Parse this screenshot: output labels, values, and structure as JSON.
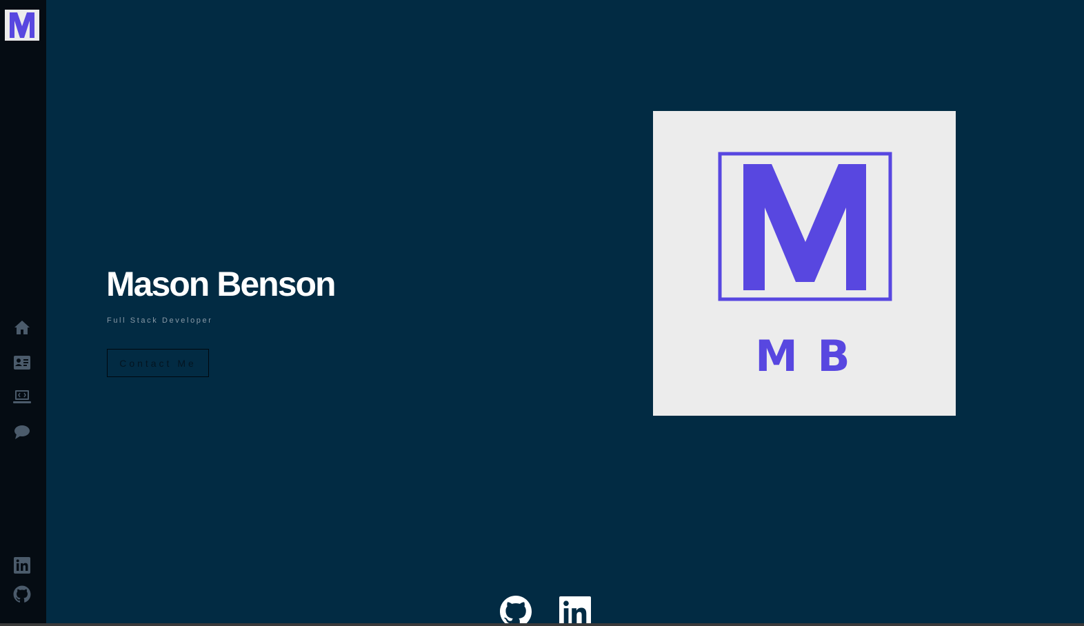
{
  "sidebar": {
    "logo_letter": "M",
    "nav": [
      {
        "name": "home",
        "icon": "home-icon"
      },
      {
        "name": "about",
        "icon": "contact-card-icon"
      },
      {
        "name": "projects",
        "icon": "laptop-code-icon"
      },
      {
        "name": "contact",
        "icon": "chat-bubble-icon"
      }
    ],
    "social": [
      {
        "name": "linkedin",
        "icon": "linkedin-icon"
      },
      {
        "name": "github",
        "icon": "github-icon"
      }
    ]
  },
  "hero": {
    "name": "Mason Benson",
    "subtitle": "Full Stack Developer",
    "button_label": "Contact Me",
    "logo_letter": "M",
    "logo_initials": "M B"
  },
  "footer_social": [
    {
      "name": "github",
      "icon": "github-icon"
    },
    {
      "name": "linkedin",
      "icon": "linkedin-icon"
    }
  ],
  "colors": {
    "background": "#022b43",
    "sidebar": "#050c13",
    "accent": "#5847e0",
    "logo_bg": "#ececec",
    "sidebar_icon": "#4b5b6b"
  }
}
